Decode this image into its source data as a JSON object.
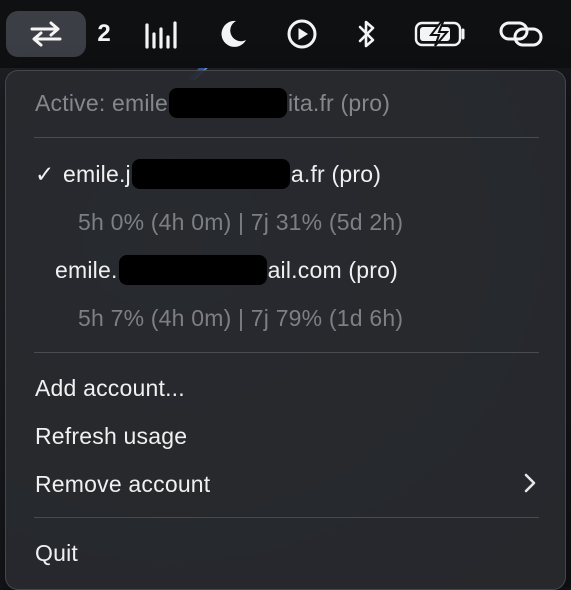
{
  "menubar": {
    "items": [
      {
        "name": "switch-arrows-icon",
        "active": true
      },
      {
        "name": "account-count",
        "label": "2"
      },
      {
        "name": "audio-levels-icon"
      },
      {
        "name": "moon-icon"
      },
      {
        "name": "play-circle-icon"
      },
      {
        "name": "bluetooth-icon"
      },
      {
        "name": "battery-charging-icon"
      },
      {
        "name": "link-icon"
      }
    ]
  },
  "menu": {
    "header": {
      "prefix": "Active: emile",
      "suffix": "ita.fr (pro)"
    },
    "accounts": [
      {
        "checked": true,
        "check_mark": "✓",
        "name_prefix": "emile.j",
        "name_suffix": "a.fr (pro)",
        "usage": "5h 0% (4h 0m) | 7j 31% (5d 2h)"
      },
      {
        "checked": false,
        "check_mark": "",
        "name_prefix": "emile.",
        "name_suffix": "ail.com (pro)",
        "usage": "5h 7% (4h 0m) | 7j 79% (1d 6h)"
      }
    ],
    "actions": {
      "add": "Add account...",
      "refresh": "Refresh usage",
      "remove": "Remove account",
      "quit": "Quit"
    }
  },
  "colors": {
    "menubar_bg": "#0f1012",
    "menu_bg": "#28292e",
    "text": "#f0f0f0",
    "dim_text": "#7d7f83",
    "active_pill": "#3b3e44",
    "streak": "#3a6fd8"
  }
}
